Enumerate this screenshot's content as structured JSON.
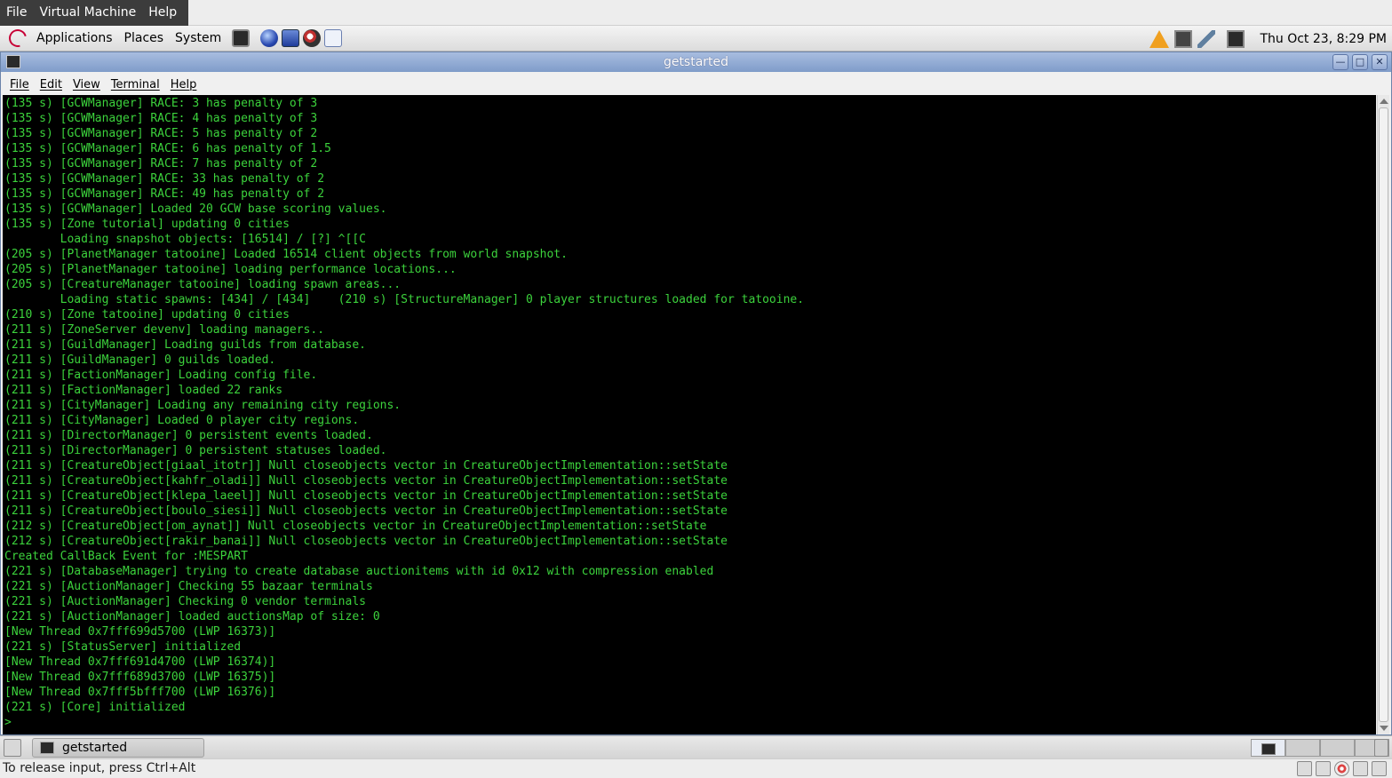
{
  "vm_menu": [
    "File",
    "Virtual Machine",
    "Help"
  ],
  "gnome_panel": {
    "menus": [
      "Applications",
      "Places",
      "System"
    ],
    "clock": "Thu Oct 23,  8:29 PM"
  },
  "window": {
    "title": "getstarted",
    "buttons": [
      "minimize",
      "maximize",
      "close"
    ],
    "menu": [
      "File",
      "Edit",
      "View",
      "Terminal",
      "Help"
    ]
  },
  "terminal": {
    "lines": [
      "(135 s) [GCWManager] RACE: 3 has penalty of 3",
      "(135 s) [GCWManager] RACE: 4 has penalty of 3",
      "(135 s) [GCWManager] RACE: 5 has penalty of 2",
      "(135 s) [GCWManager] RACE: 6 has penalty of 1.5",
      "(135 s) [GCWManager] RACE: 7 has penalty of 2",
      "(135 s) [GCWManager] RACE: 33 has penalty of 2",
      "(135 s) [GCWManager] RACE: 49 has penalty of 2",
      "(135 s) [GCWManager] Loaded 20 GCW base scoring values.",
      "(135 s) [Zone tutorial] updating 0 cities",
      "        Loading snapshot objects: [16514] / [?] ^[[C",
      "(205 s) [PlanetManager tatooine] Loaded 16514 client objects from world snapshot.",
      "(205 s) [PlanetManager tatooine] loading performance locations...",
      "(205 s) [CreatureManager tatooine] loading spawn areas...",
      "        Loading static spawns: [434] / [434]    (210 s) [StructureManager] 0 player structures loaded for tatooine.",
      "(210 s) [Zone tatooine] updating 0 cities",
      "(211 s) [ZoneServer devenv] loading managers..",
      "(211 s) [GuildManager] Loading guilds from database.",
      "(211 s) [GuildManager] 0 guilds loaded.",
      "(211 s) [FactionManager] Loading config file.",
      "(211 s) [FactionManager] loaded 22 ranks",
      "(211 s) [CityManager] Loading any remaining city regions.",
      "(211 s) [CityManager] Loaded 0 player city regions.",
      "(211 s) [DirectorManager] 0 persistent events loaded.",
      "(211 s) [DirectorManager] 0 persistent statuses loaded.",
      "(211 s) [CreatureObject[giaal_itotr]] Null closeobjects vector in CreatureObjectImplementation::setState",
      "(211 s) [CreatureObject[kahfr_oladi]] Null closeobjects vector in CreatureObjectImplementation::setState",
      "(211 s) [CreatureObject[klepa_laeel]] Null closeobjects vector in CreatureObjectImplementation::setState",
      "(211 s) [CreatureObject[boulo_siesi]] Null closeobjects vector in CreatureObjectImplementation::setState",
      "(212 s) [CreatureObject[om_aynat]] Null closeobjects vector in CreatureObjectImplementation::setState",
      "(212 s) [CreatureObject[rakir_banai]] Null closeobjects vector in CreatureObjectImplementation::setState",
      "Created CallBack Event for :MESPART",
      "(221 s) [DatabaseManager] trying to create database auctionitems with id 0x12 with compression enabled",
      "(221 s) [AuctionManager] Checking 55 bazaar terminals",
      "(221 s) [AuctionManager] Checking 0 vendor terminals",
      "(221 s) [AuctionManager] loaded auctionsMap of size: 0",
      "[New Thread 0x7fff699d5700 (LWP 16373)]",
      "(221 s) [StatusServer] initialized",
      "[New Thread 0x7fff691d4700 (LWP 16374)]",
      "[New Thread 0x7fff689d3700 (LWP 16375)]",
      "[New Thread 0x7fff5bfff700 (LWP 16376)]",
      "(221 s) [Core] initialized",
      ">"
    ]
  },
  "taskbar": {
    "task_label": "getstarted"
  },
  "vm_status": {
    "text": "To release input, press Ctrl+Alt"
  },
  "colors": {
    "terminal_fg": "#3cd23c",
    "terminal_bg": "#000000",
    "titlebar": "#8fa9d4"
  }
}
